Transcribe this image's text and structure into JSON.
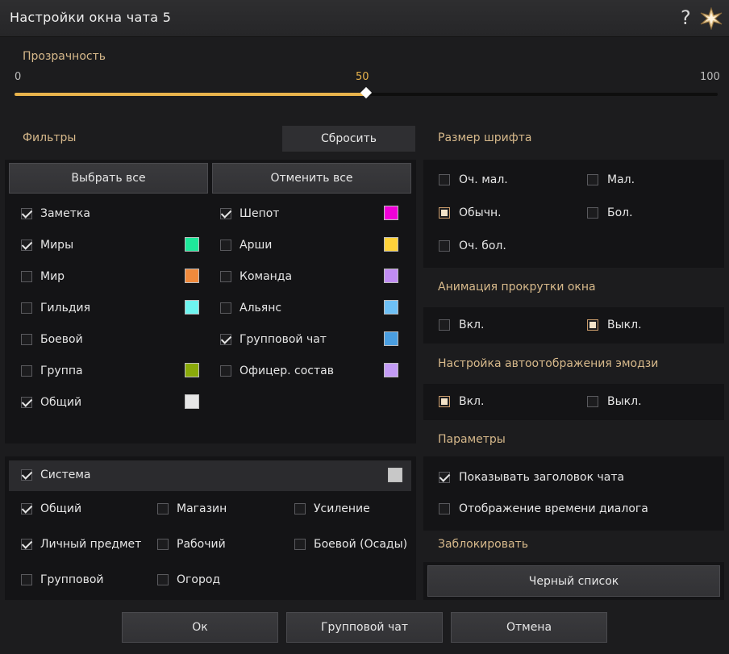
{
  "window": {
    "title": "Настройки окна чата 5"
  },
  "colors": {
    "accent": "#e8b34c",
    "gold_text": "#d7b98b",
    "panel": "#141416"
  },
  "icons": {
    "help": "question-mark-icon",
    "close": "star-close-icon"
  },
  "transparency": {
    "label": "Прозрачность",
    "min": "0",
    "mid": "50",
    "max": "100",
    "value": 50
  },
  "filters": {
    "label": "Фильтры",
    "reset": "Сбросить",
    "select_all": "Выбрать все",
    "deselect_all": "Отменить все",
    "left": [
      {
        "label": "Заметка",
        "checked": true,
        "color": null
      },
      {
        "label": "Миры",
        "checked": true,
        "color": "#1ee89a"
      },
      {
        "label": "Мир",
        "checked": false,
        "color": "#f08a3c"
      },
      {
        "label": "Гильдия",
        "checked": false,
        "color": "#6ef5f0"
      },
      {
        "label": "Боевой",
        "checked": false,
        "color": null
      },
      {
        "label": "Группа",
        "checked": false,
        "color": "#8aaa0a"
      },
      {
        "label": "Общий",
        "checked": true,
        "color": "#e6e6e6"
      }
    ],
    "right": [
      {
        "label": "Шепот",
        "checked": true,
        "color": "#f000d8"
      },
      {
        "label": "Арши",
        "checked": false,
        "color": "#ffd23a"
      },
      {
        "label": "Команда",
        "checked": false,
        "color": "#c08cf2"
      },
      {
        "label": "Альянс",
        "checked": false,
        "color": "#6ec0f5"
      },
      {
        "label": "Групповой чат",
        "checked": true,
        "color": "#4a9ee0"
      },
      {
        "label": "Офицер. состав",
        "checked": false,
        "color": "#c49cf5"
      }
    ]
  },
  "system": {
    "label": "Система",
    "checked": true,
    "color": "#c8c8c8",
    "items": [
      {
        "label": "Общий",
        "checked": true
      },
      {
        "label": "Магазин",
        "checked": false
      },
      {
        "label": "Усиление",
        "checked": false
      },
      {
        "label": "Личный предмет",
        "checked": true
      },
      {
        "label": "Рабочий",
        "checked": false
      },
      {
        "label": "Боевой (Осады)",
        "checked": false
      },
      {
        "label": "Групповой",
        "checked": false
      },
      {
        "label": "Огород",
        "checked": false
      }
    ]
  },
  "font_size": {
    "label": "Размер шрифта",
    "options": [
      {
        "label": "Оч. мал.",
        "selected": false
      },
      {
        "label": "Мал.",
        "selected": false
      },
      {
        "label": "Обычн.",
        "selected": true
      },
      {
        "label": "Бол.",
        "selected": false
      },
      {
        "label": "Оч. бол.",
        "selected": false
      }
    ]
  },
  "scroll_animation": {
    "label": "Анимация прокрутки окна",
    "options": [
      {
        "label": "Вкл.",
        "selected": false
      },
      {
        "label": "Выкл.",
        "selected": true
      }
    ]
  },
  "emoji": {
    "label": "Настройка автоотображения эмодзи",
    "options": [
      {
        "label": "Вкл.",
        "selected": true
      },
      {
        "label": "Выкл.",
        "selected": false
      }
    ]
  },
  "params": {
    "label": "Параметры",
    "options": [
      {
        "label": "Показывать заголовок чата",
        "checked": true
      },
      {
        "label": "Отображение времени диалога",
        "checked": false
      }
    ]
  },
  "block": {
    "label": "Заблокировать",
    "blacklist": "Черный список"
  },
  "footer": {
    "ok": "Ок",
    "group_chat": "Групповой чат",
    "cancel": "Отмена"
  }
}
